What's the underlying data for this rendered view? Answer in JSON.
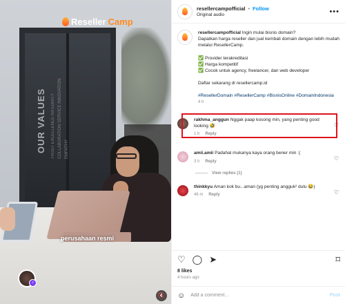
{
  "video": {
    "brand_reseller": "Reseller",
    "brand_camp": "Camp",
    "door_sign": "OUR VALUES",
    "door_values": "TRUST EXCELLENCE INTEGRITY COLLABORATION SERVICE INNOVATION EMPATHY",
    "caption": "perusahaan resmi"
  },
  "header": {
    "username": "resellercampofficial",
    "separator": "•",
    "follow_label": "Follow",
    "audio": "Original audio",
    "more_label": "•••"
  },
  "post": {
    "username": "resellercampofficial",
    "line1": "Ingin mulai bisnis domain?",
    "line2": "Dapatkan harga reseller dan jual kembali domain dengan lebih mudah melalui ResellerCamp.",
    "bullet1": "✅ Provider terakreditasi",
    "bullet2": "✅ Harga kompetitif",
    "bullet3": "✅ Cocok untuk agency, freelancer, dan web developer",
    "cta": "Daftar sekarang di resellercamp.id",
    "tags": "#ResellerDomain #ResellerCamp #BisnisOnline #DomainIndonesia",
    "time": "4 h"
  },
  "comments": [
    {
      "username": "rakhma_anggun",
      "text": "Nggak paap kosong min, yang penting good looking 🤣",
      "time": "1 h",
      "reply_label": "Reply",
      "avatar_color": "#6b4e45"
    },
    {
      "username": "amii.amii",
      "text": "Padahal mukanya kaya orang bener min :(",
      "time": "3 h",
      "reply_label": "Reply",
      "view_replies": "View replies (1)",
      "avatar_color": "#e8b7c7"
    },
    {
      "username": "thinkkyu",
      "text": "Aman kok bu...aman (yg penting angguk² dulu 😂)",
      "time": "46 m",
      "reply_label": "Reply",
      "avatar_color": "#c6202a"
    }
  ],
  "actions": {
    "like_icon": "♡",
    "comment_icon": "◯",
    "share_icon": "➤",
    "save_icon": "⌑"
  },
  "stats": {
    "likes": "8 likes",
    "ago": "4 hours ago"
  },
  "add_comment": {
    "emoji_icon": "☺",
    "placeholder": "Add a comment…",
    "post_label": "Post"
  },
  "colors": {
    "accent": "#0095f6",
    "highlight": "#e0121a",
    "brand_orange": "#ff8c21"
  }
}
